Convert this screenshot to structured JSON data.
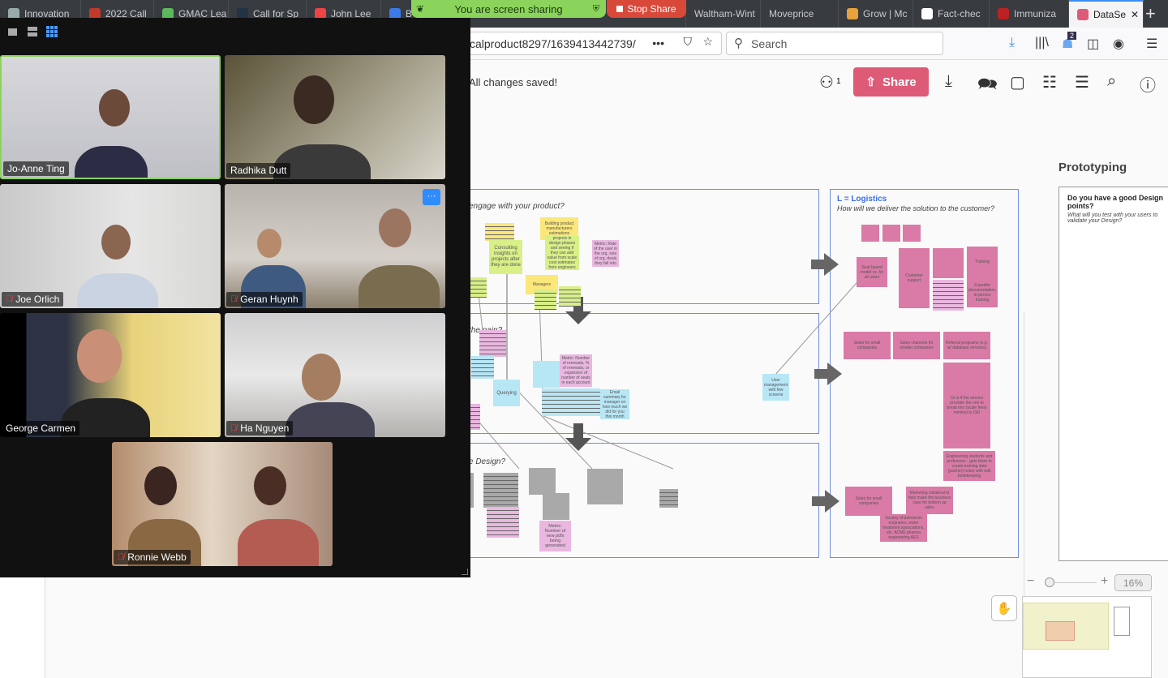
{
  "browser": {
    "tabs": [
      {
        "label": "Innovation",
        "icon": "microphone-icon",
        "color": "#9aa"
      },
      {
        "label": "2022 Call",
        "icon": "w-logo-icon",
        "color": "#c0392b"
      },
      {
        "label": "GMAC Lea",
        "icon": "house-icon",
        "color": "#5cb85c"
      },
      {
        "label": "Call for Sp",
        "icon": "fs-logo-icon",
        "color": "#234"
      },
      {
        "label": "John Lee",
        "icon": "asterisk-icon",
        "color": "#e44"
      },
      {
        "label": "B",
        "icon": "docs-icon",
        "color": "#3b7be8"
      },
      {
        "label": "Waltham-Wint",
        "icon": "none",
        "color": "#383b40"
      },
      {
        "label": "Moveprice",
        "icon": "none",
        "color": "#383b40"
      },
      {
        "label": "Grow | Mc",
        "icon": "pinwheel-icon",
        "color": "#e6a23c"
      },
      {
        "label": "Fact-chec",
        "icon": "dots-logo-icon",
        "color": "#fff"
      },
      {
        "label": "Immuniza",
        "icon": "heart-icon",
        "color": "#b22"
      },
      {
        "label": "DataSe",
        "icon": "m-logo-icon",
        "color": "#de5b78"
      }
    ],
    "url": "calproduct8297/1639413442739/",
    "search_placeholder": "Search",
    "notification_count": "2"
  },
  "screen_share": {
    "status": "You are screen sharing",
    "stop_label": "Stop Share"
  },
  "app": {
    "save_status": "All changes saved!",
    "collaborator_count": "1",
    "share_label": "Share",
    "zoom_level": "16%"
  },
  "board": {
    "frame1_question": "engage with your product?",
    "frame2_question": "the pain?",
    "frame3_question": "e Design?",
    "logistics_title": "L = Logistics",
    "logistics_question": "How will we deliver the solution to the customer?",
    "prototyping_title": "Prototyping",
    "prototyping_heading": "Do you have a good Design points?",
    "prototyping_question": "What will you test with your users to validate your Design?",
    "stickies": {
      "consulting": "Consulting insights on projects after they are done",
      "building": "Building product manufacturers estimations",
      "identifying": "Identifying projects in design phases and seeing if they can add value from scale cost estimates from engineers design",
      "metric_rate": "Metric: Rate of the user in the org, size of org, deals they fall into",
      "managers": "Managers",
      "querying": "Querying",
      "metric_renewals": "Metric: Number of renewals, % of renewals, or expansion of number of seats in each account",
      "email_summary": "Email summary for manager on how much we did for you this month",
      "user_mgmt": "User management with few screens",
      "metric_pdfs": "Metric: Number of new pdfs being generated",
      "seat_based": "Seat based model vs. for all users",
      "customer_support": "Customer support",
      "training": "Training",
      "expedite": "Expedite documentation, in-person training",
      "sales_small": "Sales for small companies",
      "sales_channels": "Sales channels for smaller companies",
      "referral": "Referral programs (e.g. w/ database services)",
      "or_if": "Or is if the service provider the one to break into (scale fees) minimal to OEI",
      "engineering": "Engineering students and professors - gets them to create training data (partner) notes with edit bookkeeping",
      "marketing": "Marketing collateral to help make the business case for bottom up sales",
      "society": "Society of petroleum engineers, water treatment associations, etc. ACME pharma engineering AES"
    }
  },
  "zoom": {
    "participants": [
      {
        "name": "Jo-Anne Ting",
        "muted": false,
        "active": true
      },
      {
        "name": "Radhika Dutt",
        "muted": false
      },
      {
        "name": "Joe Orlich",
        "muted": true
      },
      {
        "name": "Geran Huynh",
        "muted": true
      },
      {
        "name": "George Carmen",
        "muted": false
      },
      {
        "name": "Ha Nguyen",
        "muted": true
      },
      {
        "name": "Ronnie Webb",
        "muted": true
      }
    ],
    "active_color": "#8bd45b",
    "more_label": "···"
  }
}
